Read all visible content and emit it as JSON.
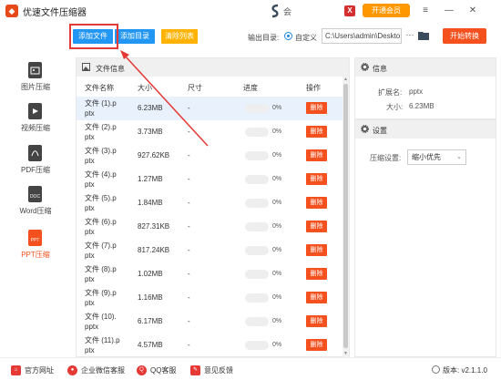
{
  "app": {
    "title": "优速文件压缩器",
    "brand_label": "会",
    "vip_button": "开通会员"
  },
  "toolbar": {
    "add_file": "添加文件",
    "add_dir": "添加目录",
    "clear_list": "清除列表",
    "output_label": "输出目录:",
    "output_mode": "自定义",
    "output_path": "C:\\Users\\admin\\Deskto",
    "browse": "···",
    "start": "开始转换"
  },
  "sidebar": {
    "items": [
      {
        "label": "图片压缩",
        "icon": "image-icon",
        "color": "#444444",
        "active": false
      },
      {
        "label": "视频压缩",
        "icon": "video-icon",
        "color": "#444444",
        "active": false
      },
      {
        "label": "PDF压缩",
        "icon": "pdf-icon",
        "color": "#444444",
        "active": false
      },
      {
        "label": "Word压缩",
        "icon": "word-icon",
        "color": "#444444",
        "active": false
      },
      {
        "label": "PPT压缩",
        "icon": "ppt-icon",
        "color": "#f4511e",
        "active": true
      }
    ],
    "icon_texts": [
      "",
      "",
      "",
      "DOC",
      "PPT"
    ]
  },
  "file_panel": {
    "title": "文件信息",
    "columns": {
      "name": "文件名称",
      "size": "大小",
      "dim": "尺寸",
      "progress": "进度",
      "action": "操作"
    },
    "rows": [
      {
        "name": "文件 (1).p\nptx",
        "size": "6.23MB",
        "dim": "-",
        "progress": 0,
        "progress_text": "0%",
        "action": "删除",
        "selected": true
      },
      {
        "name": "文件 (2).p\nptx",
        "size": "3.73MB",
        "dim": "-",
        "progress": 0,
        "progress_text": "0%",
        "action": "删除",
        "selected": false
      },
      {
        "name": "文件 (3).p\nptx",
        "size": "927.62KB",
        "dim": "-",
        "progress": 0,
        "progress_text": "0%",
        "action": "删除",
        "selected": false
      },
      {
        "name": "文件 (4).p\nptx",
        "size": "1.27MB",
        "dim": "-",
        "progress": 0,
        "progress_text": "0%",
        "action": "删除",
        "selected": false
      },
      {
        "name": "文件 (5).p\nptx",
        "size": "1.84MB",
        "dim": "-",
        "progress": 0,
        "progress_text": "0%",
        "action": "删除",
        "selected": false
      },
      {
        "name": "文件 (6).p\nptx",
        "size": "827.31KB",
        "dim": "-",
        "progress": 0,
        "progress_text": "0%",
        "action": "删除",
        "selected": false
      },
      {
        "name": "文件 (7).p\nptx",
        "size": "817.24KB",
        "dim": "-",
        "progress": 0,
        "progress_text": "0%",
        "action": "删除",
        "selected": false
      },
      {
        "name": "文件 (8).p\nptx",
        "size": "1.02MB",
        "dim": "-",
        "progress": 0,
        "progress_text": "0%",
        "action": "删除",
        "selected": false
      },
      {
        "name": "文件 (9).p\nptx",
        "size": "1.16MB",
        "dim": "-",
        "progress": 0,
        "progress_text": "0%",
        "action": "删除",
        "selected": false
      },
      {
        "name": "文件 (10).\npptx",
        "size": "6.17MB",
        "dim": "-",
        "progress": 0,
        "progress_text": "0%",
        "action": "删除",
        "selected": false
      },
      {
        "name": "文件 (11).p\nptx",
        "size": "4.57MB",
        "dim": "-",
        "progress": 0,
        "progress_text": "0%",
        "action": "删除",
        "selected": false
      }
    ]
  },
  "info_panel": {
    "title": "信息",
    "ext_label": "扩展名:",
    "ext_value": "pptx",
    "size_label": "大小:",
    "size_value": "6.23MB"
  },
  "settings_panel": {
    "title": "设置",
    "compress_label": "压缩设置:",
    "compress_value": "缩小优先"
  },
  "footer": {
    "website": "官方网址",
    "support": "企业微信客服",
    "qq": "QQ客服",
    "feedback": "意见反馈",
    "version": "版本: v2.1.1.0"
  },
  "colors": {
    "accent": "#f4511e",
    "primary": "#2196f3",
    "warning": "#ffb300",
    "highlight": "#e53935"
  }
}
